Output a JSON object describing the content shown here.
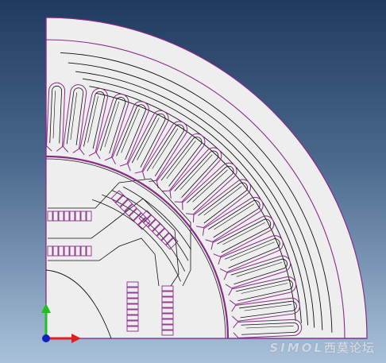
{
  "window": {
    "title": ""
  },
  "model": {
    "description_colors": {
      "background_top": "#1f3a5e",
      "background_bottom": "#a9c1da",
      "geometry_fill": "#eeeeee",
      "boundary": "#8a2a8a",
      "flux_lines": "#111111"
    },
    "stator_slot_count": 18,
    "rotor_pole_pairs_visible": 2
  },
  "axes": {
    "x_color": "#e02020",
    "y_color": "#20c020",
    "origin_color": "#1020c0"
  },
  "watermark": {
    "latin": "SIMOL",
    "cjk": "西莫论坛"
  }
}
